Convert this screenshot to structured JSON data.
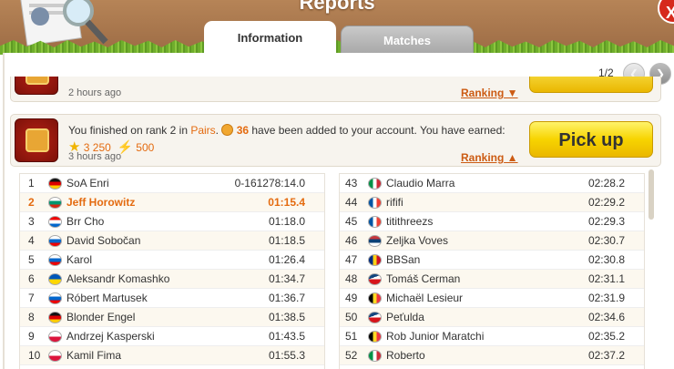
{
  "header": {
    "title": "Reports",
    "close_label": "X"
  },
  "tabs": [
    {
      "label": "Information"
    },
    {
      "label": "Matches"
    }
  ],
  "pager": {
    "text": "1/2",
    "prev": "❮",
    "next": "❯"
  },
  "prev_card": {
    "time": "2 hours ago",
    "ranking": "Ranking"
  },
  "current_card": {
    "msg_start": "You finished on rank 2 in ",
    "mode": "Pairs",
    "msg_mid": ". ",
    "coins": "36",
    "msg_end": " have been added to your account. You have earned:",
    "stars": "3 250",
    "points": "500",
    "time": "3 hours ago",
    "ranking": "Ranking",
    "pick_up": "Pick up"
  },
  "colors": {
    "accent": "#e46b10",
    "grass": "#7cb832",
    "header": "#a8764d"
  },
  "left_rows": [
    {
      "rank": "1",
      "name": "SoA Enri",
      "score": "0-161278:14.0",
      "flag": "de",
      "me": false
    },
    {
      "rank": "2",
      "name": "Jeff Horowitz",
      "score": "01:15.4",
      "flag": "bg",
      "me": true
    },
    {
      "rank": "3",
      "name": "Brr Cho",
      "score": "01:18.0",
      "flag": "hr",
      "me": false
    },
    {
      "rank": "4",
      "name": "David Sobočan",
      "score": "01:18.5",
      "flag": "si",
      "me": false
    },
    {
      "rank": "5",
      "name": "Karol",
      "score": "01:26.4",
      "flag": "sk",
      "me": false
    },
    {
      "rank": "6",
      "name": "Aleksandr Komashko",
      "score": "01:34.7",
      "flag": "ua",
      "me": false
    },
    {
      "rank": "7",
      "name": "Róbert Martusek",
      "score": "01:36.7",
      "flag": "sk",
      "me": false
    },
    {
      "rank": "8",
      "name": "Blonder Engel",
      "score": "01:38.5",
      "flag": "de",
      "me": false
    },
    {
      "rank": "9",
      "name": "Andrzej Kasperski",
      "score": "01:43.5",
      "flag": "pl",
      "me": false
    },
    {
      "rank": "10",
      "name": "Kamil Fima",
      "score": "01:55.3",
      "flag": "pl",
      "me": false
    }
  ],
  "right_rows": [
    {
      "rank": "43",
      "name": "Claudio Marra",
      "score": "02:28.2",
      "flag": "it"
    },
    {
      "rank": "44",
      "name": "rififi",
      "score": "02:29.2",
      "flag": "fr"
    },
    {
      "rank": "45",
      "name": "titithreezs",
      "score": "02:29.3",
      "flag": "fr"
    },
    {
      "rank": "46",
      "name": "Zeljka Voves",
      "score": "02:30.7",
      "flag": "rs"
    },
    {
      "rank": "47",
      "name": "BBSan",
      "score": "02:30.8",
      "flag": "ro"
    },
    {
      "rank": "48",
      "name": "Tomáš Cerman",
      "score": "02:31.1",
      "flag": "cz"
    },
    {
      "rank": "49",
      "name": "Michaël Lesieur",
      "score": "02:31.9",
      "flag": "be"
    },
    {
      "rank": "50",
      "name": "Peťulda",
      "score": "02:34.6",
      "flag": "cz"
    },
    {
      "rank": "51",
      "name": "Rob Junior Maratchi",
      "score": "02:35.2",
      "flag": "be"
    },
    {
      "rank": "52",
      "name": "Roberto",
      "score": "02:37.2",
      "flag": "it"
    }
  ]
}
